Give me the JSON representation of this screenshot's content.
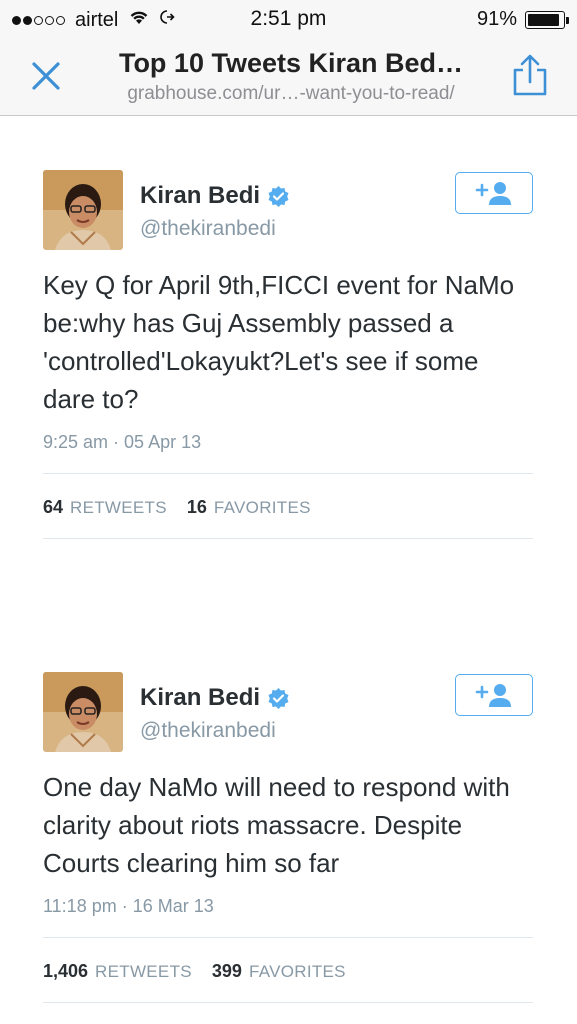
{
  "status_bar": {
    "carrier": "airtel",
    "time": "2:51 pm",
    "battery_percent": "91%",
    "battery_level": 0.91,
    "signal_bars_filled": 2,
    "signal_bars_total": 5
  },
  "nav": {
    "title": "Top 10 Tweets Kiran Bed…",
    "url": "grabhouse.com/ur…-want-you-to-read/"
  },
  "colors": {
    "accent": "#55acee",
    "ios_blue": "#3d8fd6",
    "text_primary": "#292f33",
    "text_secondary": "#8899a6",
    "divider": "#e1e8ed"
  },
  "tweets": [
    {
      "author_name": "Kiran Bedi",
      "handle": "@thekiranbedi",
      "text": "Key Q for April 9th,FICCI event for NaMo be:why has Guj Assembly passed a 'controlled'Lokayukt?Let's see if some dare to?",
      "timestamp": "9:25 am · 05 Apr 13",
      "retweets": "64",
      "retweets_label": "RETWEETS",
      "favorites": "16",
      "favorites_label": "FAVORITES"
    },
    {
      "author_name": "Kiran Bedi",
      "handle": "@thekiranbedi",
      "text": "One day NaMo will need to respond with clarity about riots massacre. Despite Courts clearing him so far",
      "timestamp": "11:18 pm · 16 Mar 13",
      "retweets": "1,406",
      "retweets_label": "RETWEETS",
      "favorites": "399",
      "favorites_label": "FAVORITES"
    }
  ]
}
